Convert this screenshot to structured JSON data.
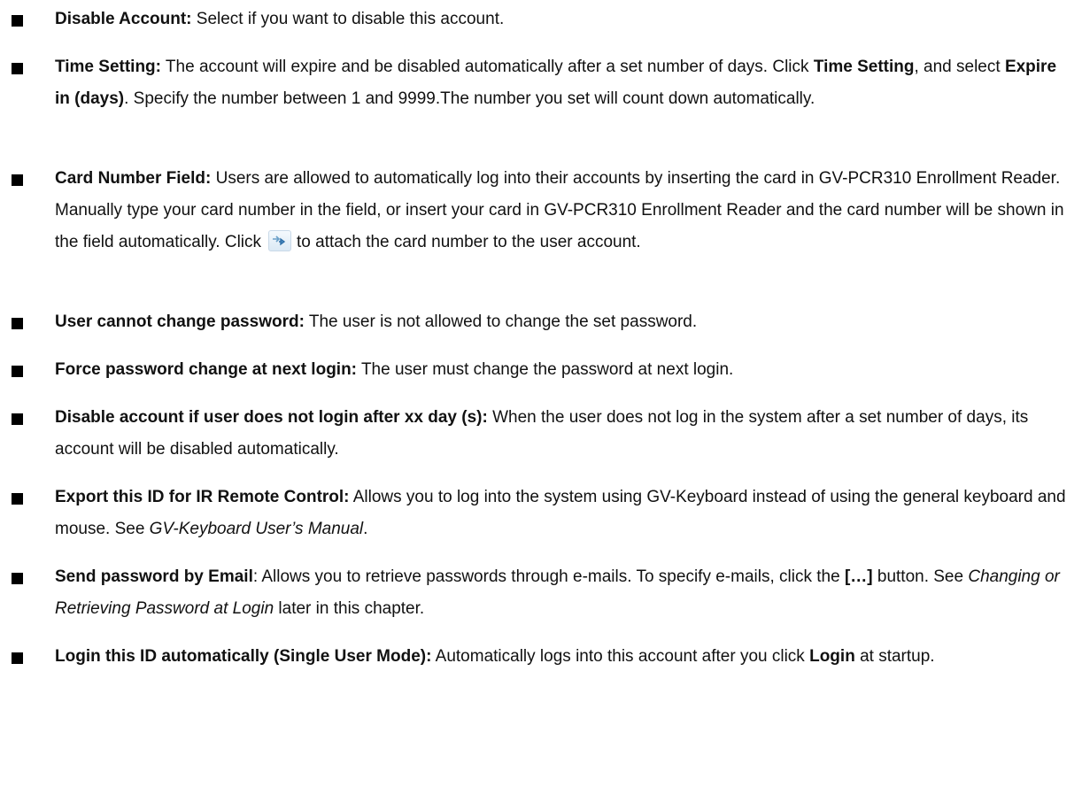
{
  "items": [
    {
      "term": "Disable Account:",
      "text": " Select if you want to disable this account."
    },
    {
      "term": "Time Setting:",
      "t1": " The account will expire and be disabled automatically after a set number of days. Click ",
      "b1": "Time Setting",
      "t2": ", and select ",
      "b2": "Expire in (days)",
      "t3": ". Specify the number between 1 and 9999.The number you set will count down automatically."
    },
    {
      "term": "Card Number Field:",
      "t1": " Users are allowed to automatically log into their accounts by inserting the card in GV-PCR310 Enrollment Reader. Manually type your card number in the field, or insert your card in GV-PCR310 Enrollment Reader and the card number will be shown in the field automatically. Click",
      "t2": "to attach the card number to the user account.",
      "icon": "attach-arrow-icon"
    },
    {
      "term": "User cannot change password:",
      "text": " The user is not allowed to change the set password."
    },
    {
      "term": "Force password change at next login:",
      "text": " The user must change the password at next login."
    },
    {
      "term": "Disable account if user does not login after xx day (s):",
      "text": " When the user does not log in the system after a set number of days, its account will be disabled automatically."
    },
    {
      "term": "Export this ID for IR Remote Control:",
      "t1": " Allows you to log into the system using GV-Keyboard instead of using the general keyboard and mouse. See ",
      "i1": "GV-Keyboard User’s Manual",
      "t2": "."
    },
    {
      "term": "Send password by Email",
      "t1": ": Allows you to retrieve passwords through e-mails. To specify e-mails, click the ",
      "b1": "[…]",
      "t2": " button. See ",
      "i1": "Changing or Retrieving Password at Login",
      "t3": " later in this chapter."
    },
    {
      "term": "Login this ID automatically (Single User Mode):",
      "t1": " Automatically logs into this account after you click ",
      "b1": "Login",
      "t2": " at startup."
    }
  ]
}
